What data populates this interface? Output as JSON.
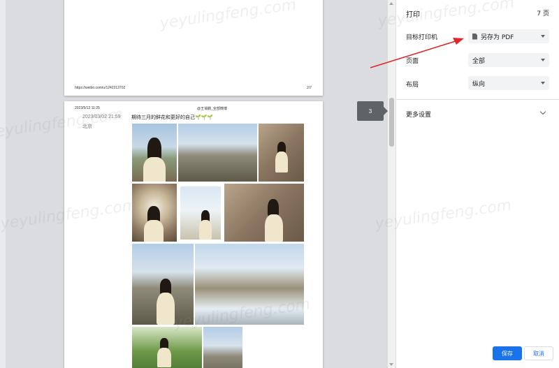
{
  "preview": {
    "page1": {
      "footer_url": "https://weibo.com/u/1242213702",
      "footer_page": "2/7"
    },
    "page2": {
      "header_datetime": "2023/5/12 11:25",
      "header_author": "@王俏鹏_全部微博",
      "post_date": "2023/03/02 21:59",
      "post_location": "北京",
      "post_text": "期待三月的鲜花和更好的自己",
      "post_emoji": "🌱🌱🌱"
    },
    "page_badge": "3"
  },
  "panel": {
    "title": "打印",
    "page_count": "7 页",
    "destination_label": "目标打印机",
    "destination_value": "另存为 PDF",
    "pages_label": "页面",
    "pages_value": "全部",
    "layout_label": "布局",
    "layout_value": "纵向",
    "more_settings_label": "更多设置",
    "save_label": "保存",
    "cancel_label": "取消"
  },
  "watermark": "yeyulingfeng.com",
  "colors": {
    "accent": "#1a73e8",
    "annotation_arrow": "#e0262b"
  }
}
